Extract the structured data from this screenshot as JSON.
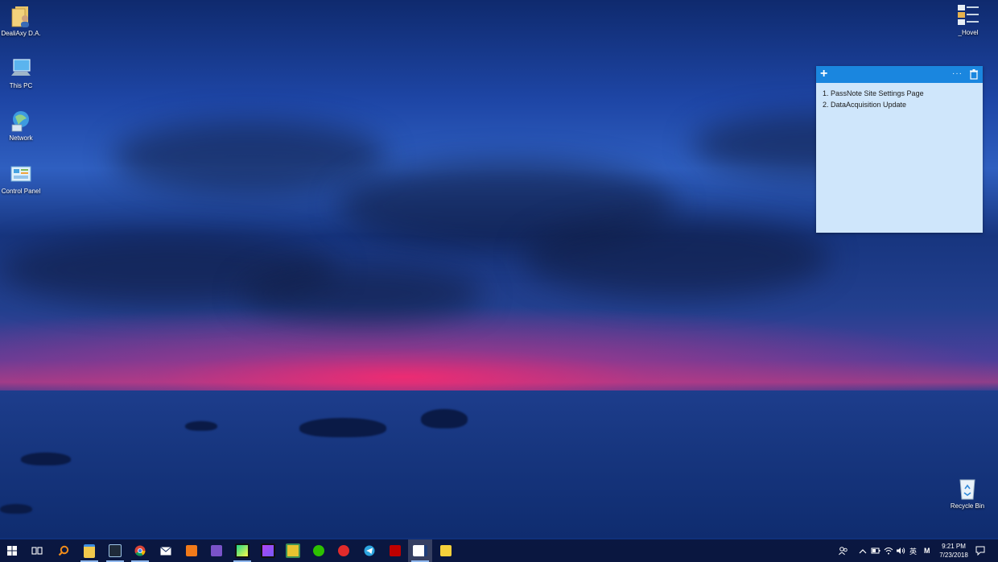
{
  "desktop": {
    "icons_left": [
      {
        "label": "DealiAxy D.A.",
        "icon": "user-folder-icon"
      },
      {
        "label": "This PC",
        "icon": "computer-icon"
      },
      {
        "label": "Network",
        "icon": "network-icon"
      },
      {
        "label": "Control Panel",
        "icon": "control-panel-icon"
      }
    ],
    "icon_top_right": {
      "label": "_Hovel",
      "icon": "folder-list-icon"
    },
    "recycle_bin": {
      "label": "Recycle Bin",
      "icon": "recycle-bin-icon"
    }
  },
  "sticky_note": {
    "add_glyph": "+",
    "menu_glyph": "···",
    "lines": [
      "1. PassNote Site Settings Page",
      "2. DataAcquisition Update"
    ],
    "background": "#cfe6fb",
    "bar_color": "#1a86df"
  },
  "taskbar": {
    "apps": [
      "start-icon",
      "task-view-icon",
      "search-icon",
      "file-explorer-icon",
      "terminal-icon",
      "chrome-icon",
      "mail-icon",
      "sublime-icon",
      "visual-studio-icon",
      "pycharm-icon",
      "phpstorm-icon",
      "app-icon",
      "wechat-icon",
      "netease-music-icon",
      "telegram-icon",
      "filezilla-icon",
      "sticky-notes-icon",
      "notes-icon"
    ],
    "tray": {
      "ime_lang": "英",
      "ime_mode": "M",
      "time": "9:21 PM",
      "date": "7/23/2018"
    }
  }
}
